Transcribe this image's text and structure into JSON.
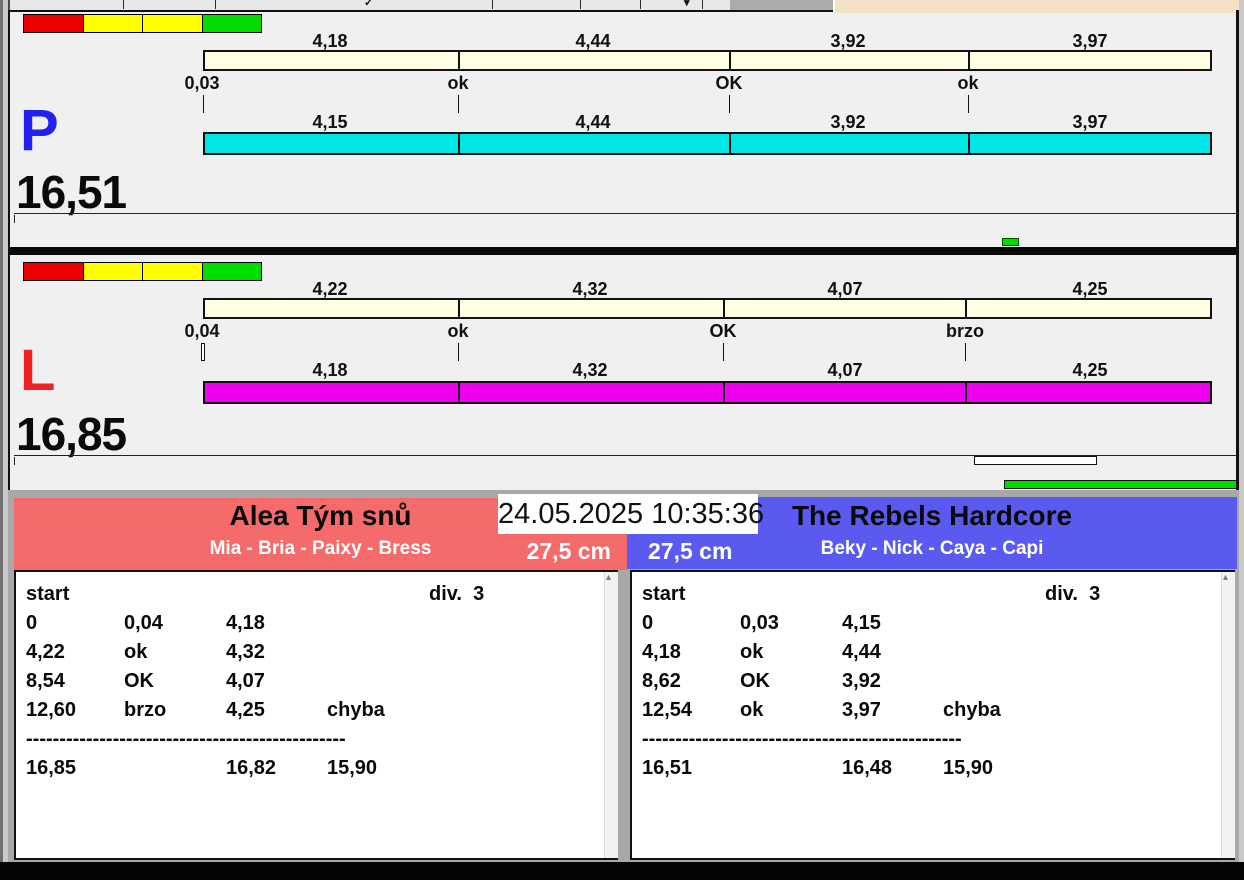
{
  "icons": {
    "scroll_up": "▴",
    "dropdown_caret": "▾",
    "check": "✓"
  },
  "colors": {
    "traffic_red": "#EE0000",
    "traffic_yellow": "#FFFF00",
    "traffic_green": "#00DB00",
    "split_bar": "#FFFDE2",
    "lane_p_bar": "#00E6E6",
    "lane_l_bar": "#EE00EE",
    "lane_p_letter": "#2222EE",
    "lane_l_letter": "#EE2222",
    "team_left_bg": "#F56A6A",
    "team_right_bg": "#5A5AF0"
  },
  "datetime": "24.05.2025 10:35:36",
  "lane_p": {
    "label": "P",
    "total": "16,51",
    "top_values": [
      "4,18",
      "4,44",
      "3,92",
      "3,97"
    ],
    "status_labels": [
      "0,03",
      "ok",
      "OK",
      "ok"
    ],
    "bottom_values": [
      "4,15",
      "4,44",
      "3,92",
      "3,97"
    ]
  },
  "lane_l": {
    "label": "L",
    "total": "16,85",
    "top_values": [
      "4,22",
      "4,32",
      "4,07",
      "4,25"
    ],
    "status_labels": [
      "0,04",
      "ok",
      "OK",
      "brzo"
    ],
    "bottom_values": [
      "4,18",
      "4,32",
      "4,07",
      "4,25"
    ]
  },
  "team_left": {
    "name": "Alea Tým snů",
    "members": "Mia - Bria - Paixy - Bress",
    "height": "27,5 cm",
    "table": {
      "header_left": "start",
      "header_right": "div.  3",
      "rows": [
        [
          "0",
          "0,04",
          "4,18",
          ""
        ],
        [
          "4,22",
          "ok",
          "4,32",
          ""
        ],
        [
          "8,54",
          "OK",
          "4,07",
          ""
        ],
        [
          "12,60",
          "brzo",
          "4,25",
          "chyba"
        ]
      ],
      "separator": "------------------------------------------------",
      "totals": [
        "16,85",
        "16,82",
        "15,90"
      ]
    }
  },
  "team_right": {
    "name": "The Rebels Hardcore",
    "members": "Beky - Nick - Caya - Capi",
    "height": "27,5 cm",
    "table": {
      "header_left": "start",
      "header_right": "div.  3",
      "rows": [
        [
          "0",
          "0,03",
          "4,15",
          ""
        ],
        [
          "4,18",
          "ok",
          "4,44",
          ""
        ],
        [
          "8,62",
          "OK",
          "3,92",
          ""
        ],
        [
          "12,54",
          "ok",
          "3,97",
          "chyba"
        ]
      ],
      "separator": "------------------------------------------------",
      "totals": [
        "16,51",
        "16,48",
        "15,90"
      ]
    }
  }
}
